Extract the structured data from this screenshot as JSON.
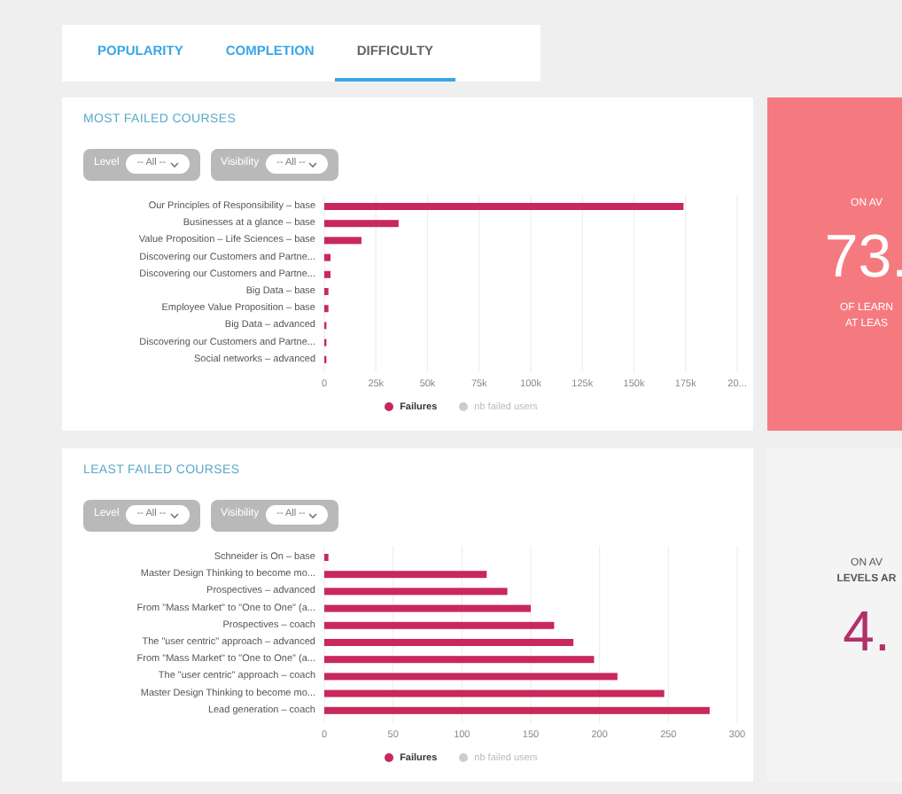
{
  "tabs": [
    {
      "label": "POPULARITY",
      "selected": false
    },
    {
      "label": "COMPLETION",
      "selected": false
    },
    {
      "label": "DIFFICULTY",
      "selected": true
    }
  ],
  "panels": [
    {
      "title": "MOST FAILED COURSES",
      "filters": [
        {
          "label": "Level",
          "value": "-- All --"
        },
        {
          "label": "Visibility",
          "value": "-- All --"
        }
      ],
      "legend": [
        {
          "label": "nb failed users",
          "color": "#cccccc",
          "active": false
        }
      ],
      "chart_data": {
        "type": "bar",
        "orientation": "horizontal",
        "grid": true,
        "categories": [
          "Our Principles of Responsibility – base",
          "Businesses at a glance – base",
          "Value Proposition – Life Sciences – base",
          "Discovering our Customers and Partne...",
          "Discovering our Customers and Partne...",
          "Big Data – base",
          "Employee Value Proposition – base",
          "Big Data – advanced",
          "Discovering our Customers and Partne...",
          "Social networks – advanced"
        ],
        "series": [
          {
            "name": "Failures",
            "color": "#c8285a",
            "values": [
              174000,
              36000,
              18000,
              3000,
              3000,
              2000,
              2000,
              1000,
              1000,
              1000
            ]
          }
        ],
        "xlim": [
          0,
          200000
        ],
        "xticks": [
          {
            "value": 0,
            "label": "0"
          },
          {
            "value": 25000,
            "label": "25k"
          },
          {
            "value": 50000,
            "label": "50k"
          },
          {
            "value": 75000,
            "label": "75k"
          },
          {
            "value": 100000,
            "label": "100k"
          },
          {
            "value": 125000,
            "label": "125k"
          },
          {
            "value": 150000,
            "label": "150k"
          },
          {
            "value": 175000,
            "label": "175k"
          },
          {
            "value": 200000,
            "label": "20..."
          }
        ]
      }
    },
    {
      "title": "LEAST FAILED COURSES",
      "filters": [
        {
          "label": "Level",
          "value": "-- All --"
        },
        {
          "label": "Visibility",
          "value": "-- All --"
        }
      ],
      "legend": [
        {
          "label": "nb failed users",
          "color": "#cccccc",
          "active": false
        }
      ],
      "chart_data": {
        "type": "bar",
        "orientation": "horizontal",
        "grid": true,
        "categories": [
          "Schneider is On – base",
          "Master Design Thinking to become mo...",
          "Prospectives – advanced",
          "From \"Mass Market\" to \"One to One\" (a...",
          "Prospectives – coach",
          "The \"user centric\" approach – advanced",
          "From \"Mass Market\" to \"One to One\" (a...",
          "The \"user centric\" approach – coach",
          "Master Design Thinking to become mo...",
          "Lead generation – coach"
        ],
        "series": [
          {
            "name": "Failures",
            "color": "#c8285a",
            "values": [
              3,
              118,
              133,
              150,
              167,
              181,
              196,
              213,
              247,
              280
            ]
          }
        ],
        "xlim": [
          0,
          300
        ],
        "xticks": [
          0,
          50,
          100,
          150,
          200,
          250,
          300
        ]
      }
    }
  ],
  "cards": [
    {
      "kind": "highlight",
      "lines": [
        "ON AV"
      ],
      "value": "73.",
      "footer": [
        "OF LEARN",
        "AT LEAS"
      ]
    },
    {
      "kind": "plain",
      "lines": [
        "ON AV",
        "LEVELS AR"
      ],
      "value": "4."
    }
  ]
}
